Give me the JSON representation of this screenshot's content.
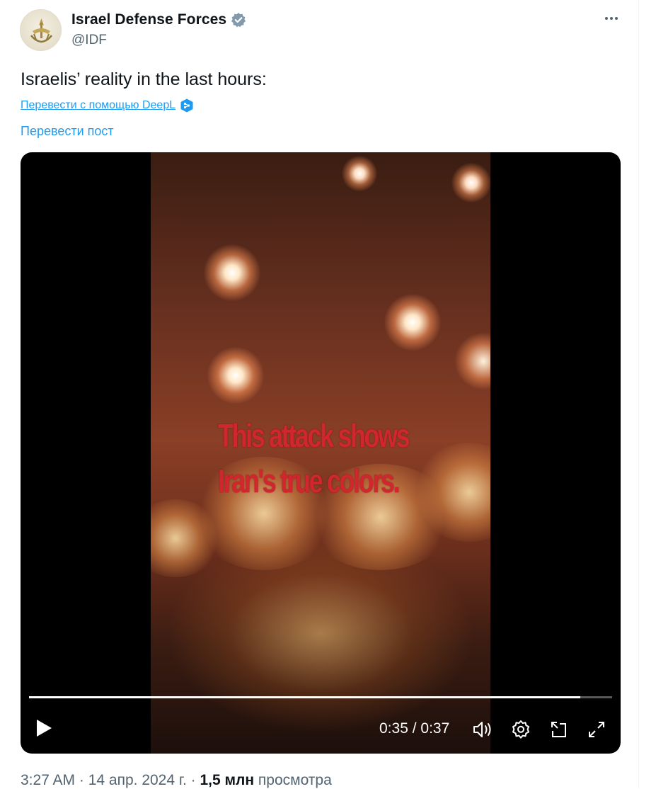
{
  "author": {
    "display_name": "Israel Defense Forces",
    "handle": "@IDF",
    "verified": true,
    "avatar_icon": "idf-emblem-icon"
  },
  "post": {
    "text": "Israelis’ reality in the last hours:",
    "deepl_link": "Перевести с помощью DeepL",
    "translate_label": "Перевести пост"
  },
  "video": {
    "caption_line1": "This attack shows",
    "caption_line2": "Iran's true colors.",
    "time_current": "0:35",
    "time_separator": " / ",
    "time_total": "0:37",
    "progress_fraction": 0.945
  },
  "meta": {
    "time": "3:27 AM",
    "sep1": " · ",
    "date": "14 апр. 2024 г.",
    "sep2": " · ",
    "views_count": "1,5 млн",
    "views_label": " просмотра"
  },
  "colors": {
    "accent": "#1d9bf0",
    "verified_badge": "#829aab",
    "caption": "#d0262d"
  }
}
